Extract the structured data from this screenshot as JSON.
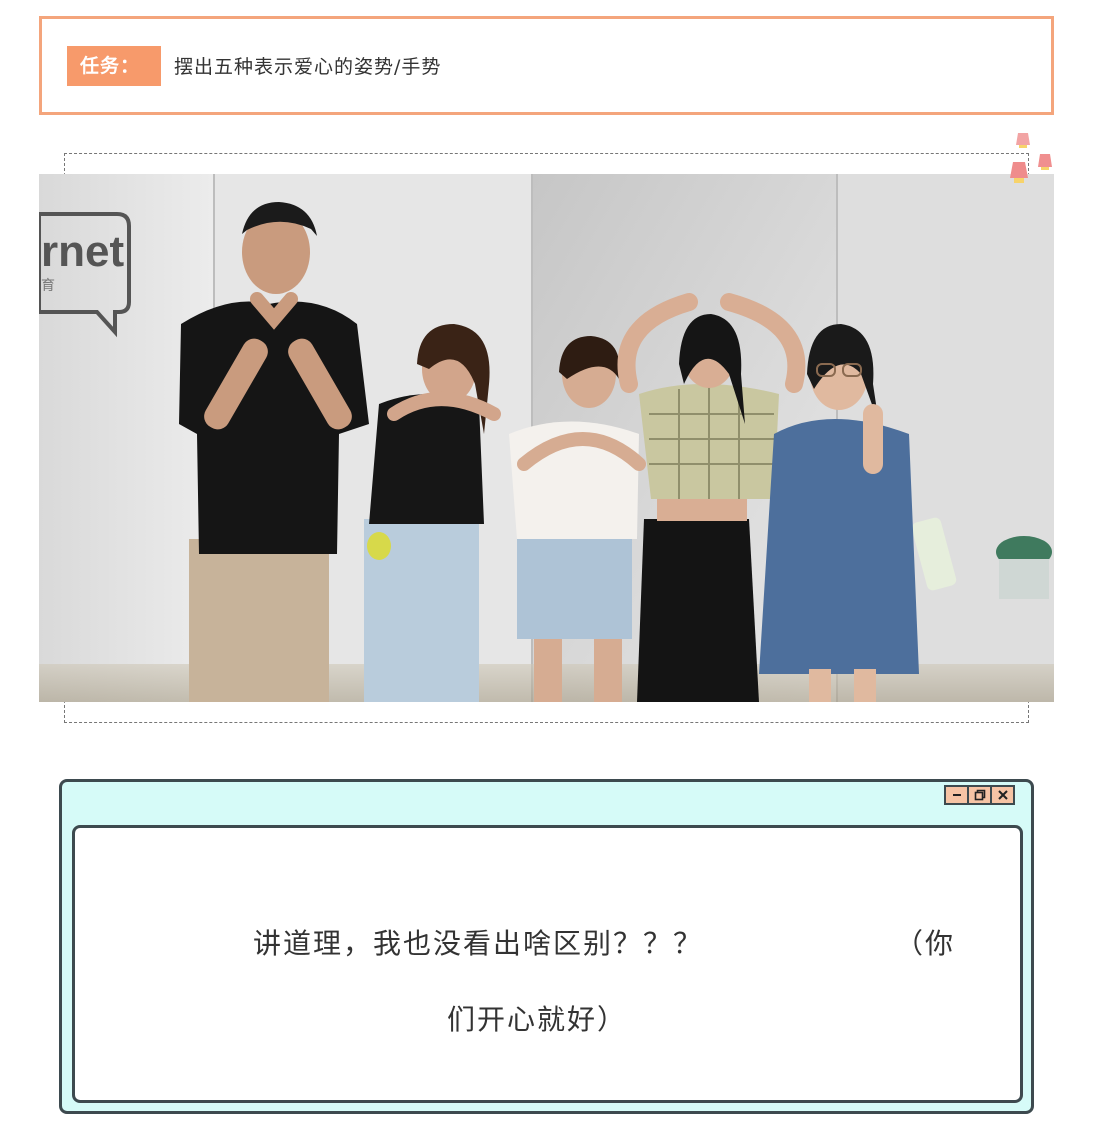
{
  "task": {
    "tag_label": "任务：",
    "text": "摆出五种表示爱心的姿势/手势"
  },
  "photo": {
    "wall_logo_text": "rnet",
    "wall_logo_sub": "育"
  },
  "window": {
    "line1": "讲道理，我也没看出啥区别？？？",
    "line1_tail": "（你",
    "line2": "们开心就好）",
    "controls": [
      "minimize-icon",
      "restore-icon",
      "close-icon"
    ]
  },
  "colors": {
    "accent": "#f79a6b",
    "card_border": "#f4a57c",
    "window_bg": "#d6fbf8",
    "window_border": "#3d4a4f"
  }
}
